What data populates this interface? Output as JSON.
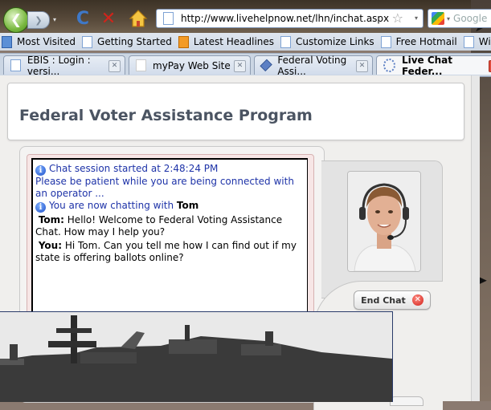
{
  "toolbar": {
    "back_glyph": "❮",
    "forward_glyph": "❯",
    "dropdown_glyph": "▾",
    "reload_glyph": "C",
    "stop_glyph": "✕",
    "url": "http://www.livehelpnow.net/lhn/inchat.aspx",
    "bookmark_star_glyph": "☆",
    "search_placeholder": "Google"
  },
  "bookmarks": [
    {
      "label": "Most Visited",
      "icon": "blue"
    },
    {
      "label": "Getting Started",
      "icon": "page"
    },
    {
      "label": "Latest Headlines",
      "icon": "rss"
    },
    {
      "label": "Customize Links",
      "icon": "page"
    },
    {
      "label": "Free Hotmail",
      "icon": "page"
    },
    {
      "label": "Windows Marketplace",
      "icon": "page"
    }
  ],
  "tabs": [
    {
      "label": "EBIS : Login : versi...",
      "active": false
    },
    {
      "label": "myPay Web Site",
      "active": false
    },
    {
      "label": "Federal Voting Assi...",
      "active": false
    },
    {
      "label": "Live Chat Feder...",
      "active": true
    }
  ],
  "page": {
    "title": "Federal Voter Assistance Program"
  },
  "chat": {
    "session_started": "Chat session started at 2:48:24 PM",
    "waiting": "Please be patient while you are being connected with an operator ...",
    "now_chatting_prefix": "You are now chatting with ",
    "agent_name": "Tom",
    "messages": [
      {
        "speaker": "Tom:",
        "text": " Hello! Welcome to Federal Voting Assistance Chat. How may I help you?"
      },
      {
        "speaker": "You:",
        "text": " Hi Tom. Can you tell me how I can find out if my state is offering ballots online?"
      }
    ]
  },
  "agent_panel": {
    "end_chat_label": "End Chat",
    "end_chat_glyph": "✕"
  },
  "colors": {
    "system_text": "#1e33a8",
    "title_text": "#4b5462",
    "green_back": "#79b840",
    "stop_red": "#d0241b"
  }
}
